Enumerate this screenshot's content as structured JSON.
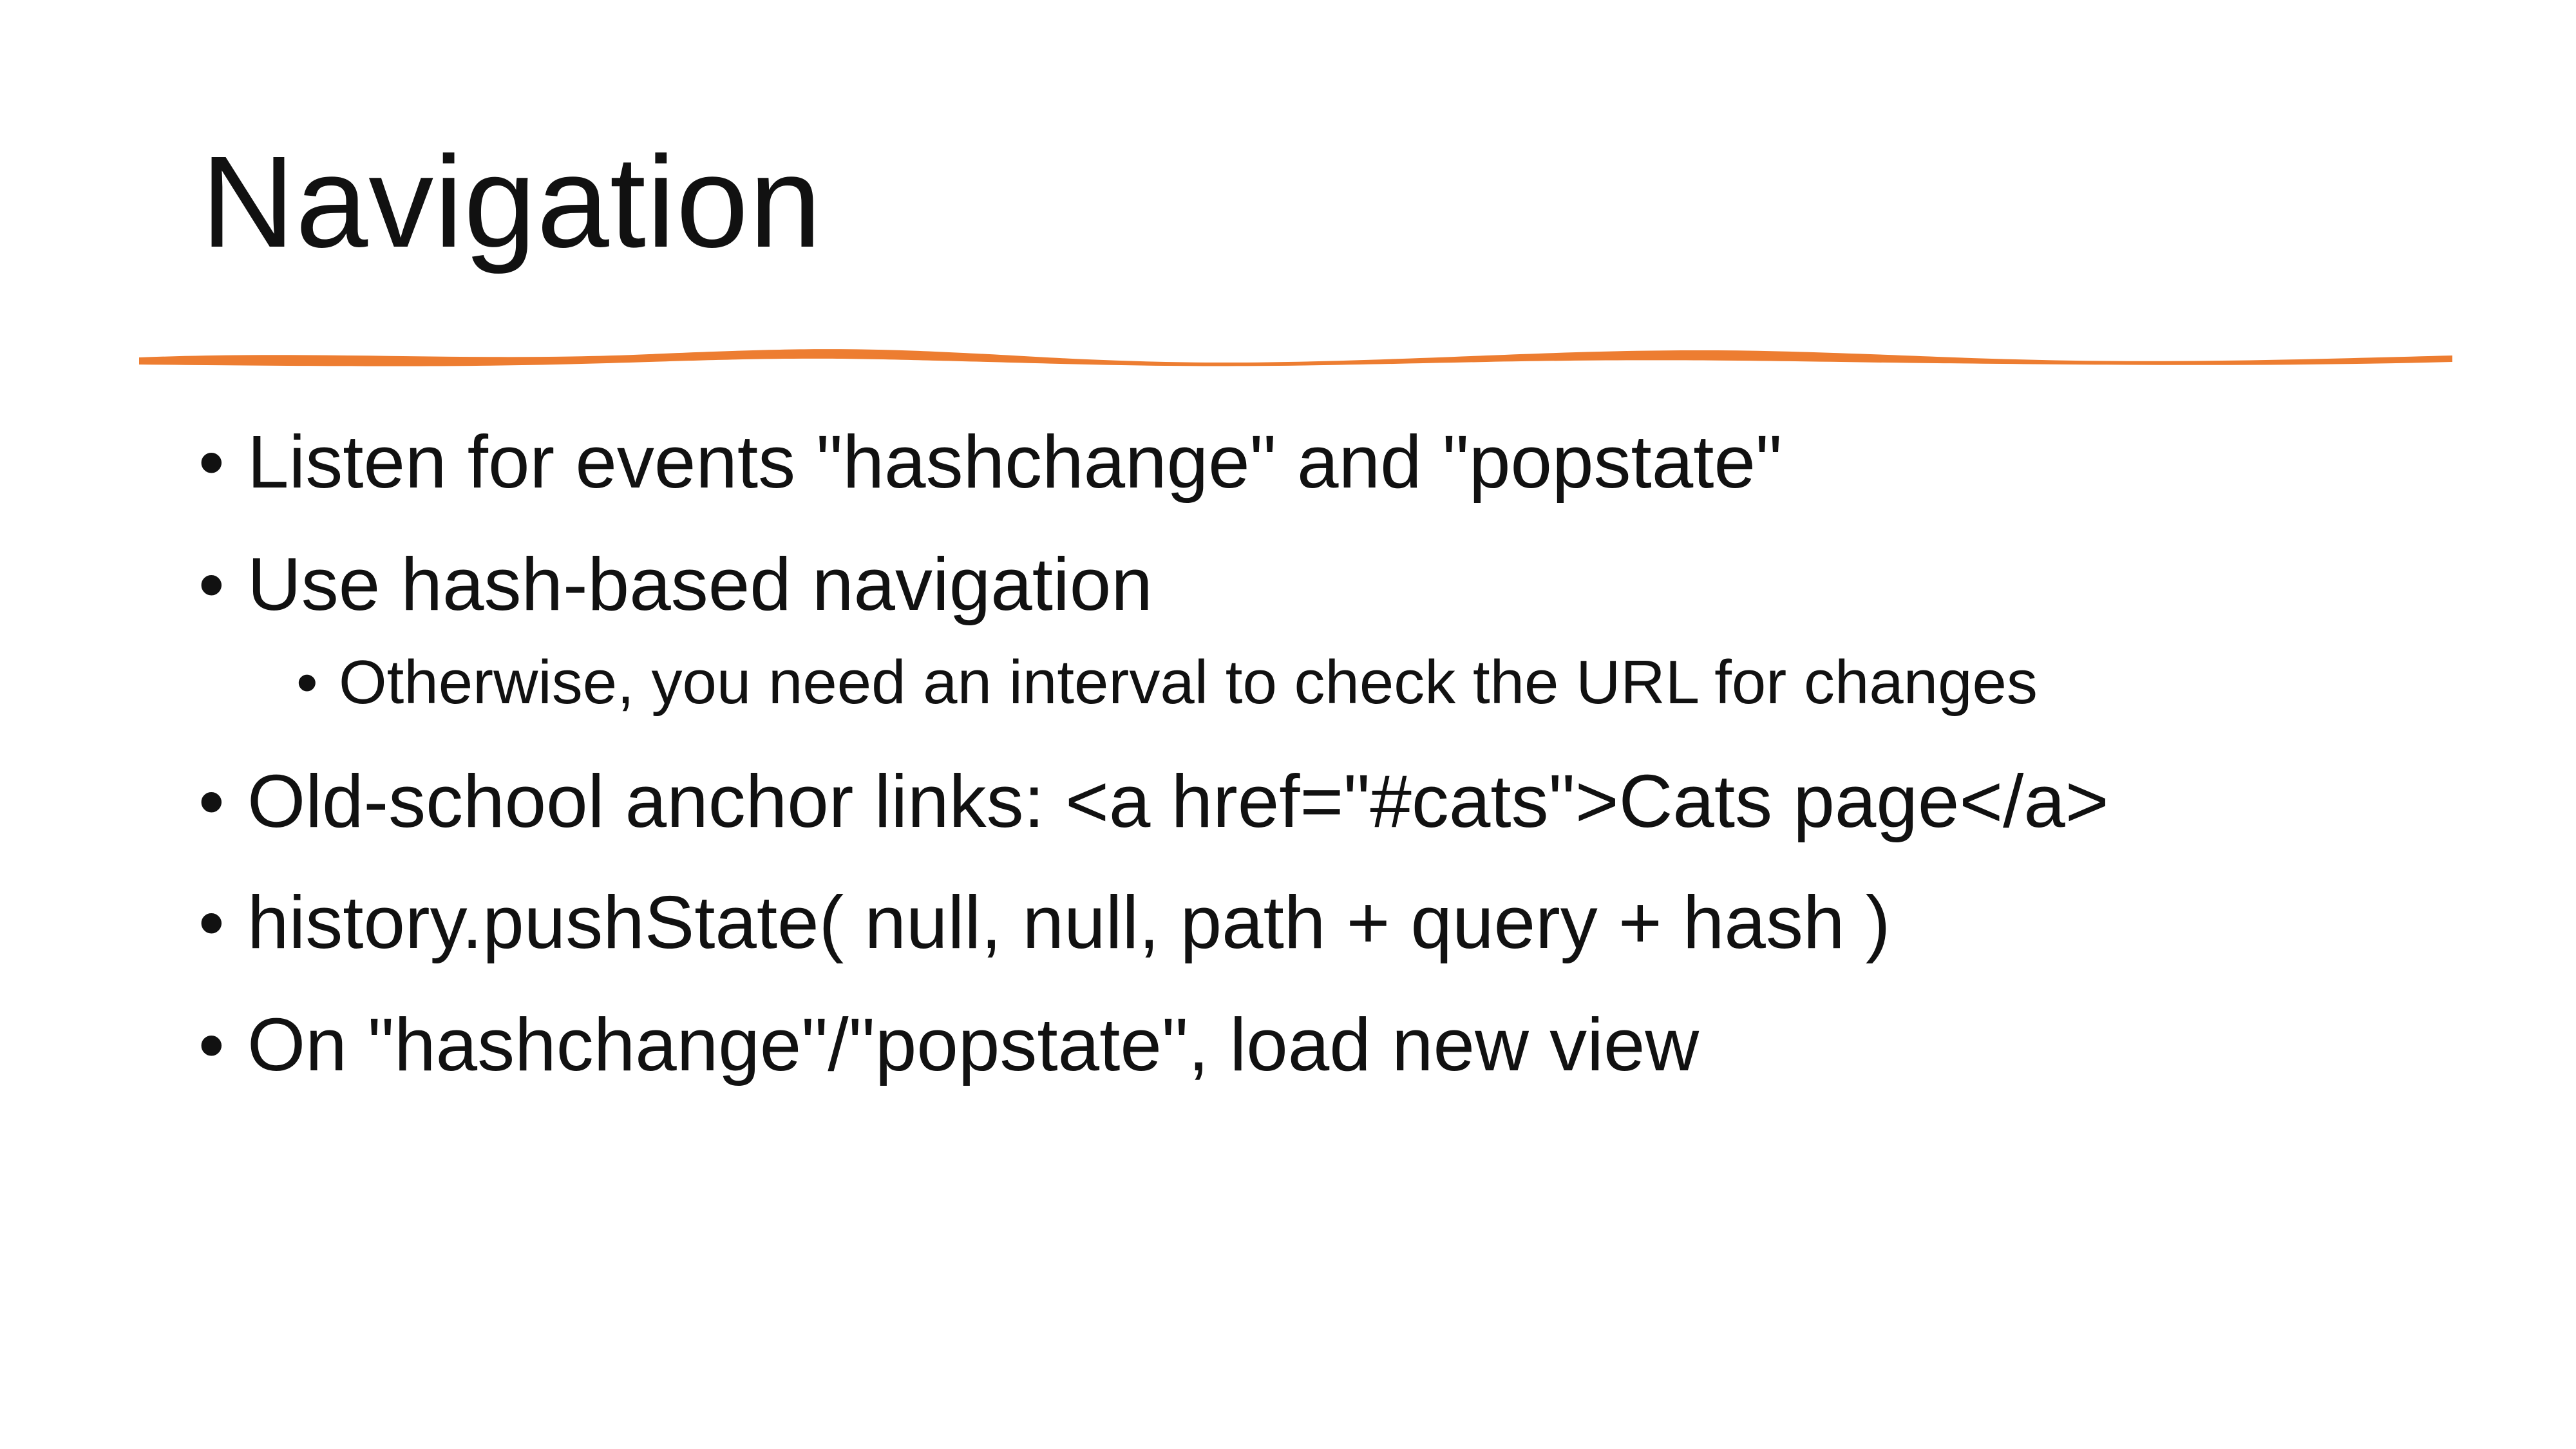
{
  "slide": {
    "title": "Navigation",
    "accent_color": "#ED7D31",
    "bullet_glyph": "•",
    "bullets": [
      {
        "level": 1,
        "text": "Listen for events \"hashchange\" and \"popstate\""
      },
      {
        "level": 1,
        "text": "Use hash-based navigation"
      },
      {
        "level": 2,
        "text": "Otherwise, you need an interval to check the URL for changes"
      },
      {
        "level": 1,
        "text": "Old-school anchor links: <a href=\"#cats\">Cats page</a>"
      },
      {
        "level": 1,
        "text": "history.pushState( null, null, path + query + hash )"
      },
      {
        "level": 1,
        "text": "On \"hashchange\"/\"popstate\", load new view"
      }
    ]
  }
}
